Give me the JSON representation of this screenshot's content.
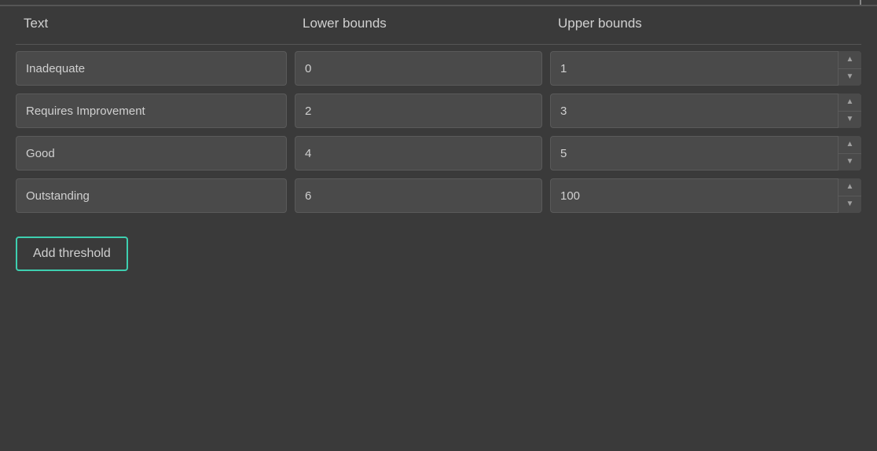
{
  "columns": {
    "text": "Text",
    "lower_bounds": "Lower bounds",
    "upper_bounds": "Upper bounds"
  },
  "rows": [
    {
      "id": 0,
      "text": "Inadequate",
      "lower_bound": "0",
      "upper_bound": "1"
    },
    {
      "id": 1,
      "text": "Requires Improvement",
      "lower_bound": "2",
      "upper_bound": "3"
    },
    {
      "id": 2,
      "text": "Good",
      "lower_bound": "4",
      "upper_bound": "5"
    },
    {
      "id": 3,
      "text": "Outstanding",
      "lower_bound": "6",
      "upper_bound": "100"
    }
  ],
  "add_button_label": "Add threshold",
  "spinner_up": "▲",
  "spinner_down": "▼"
}
